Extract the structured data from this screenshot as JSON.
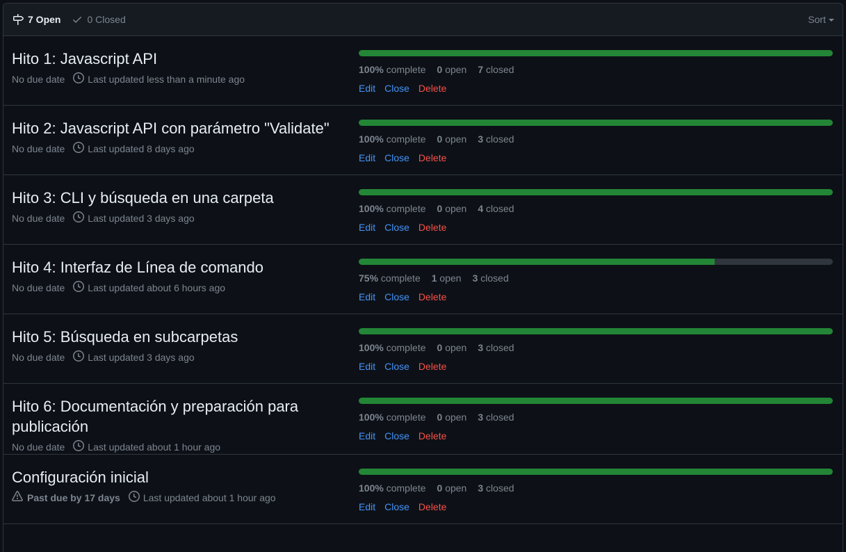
{
  "header": {
    "open_label": "7 Open",
    "closed_label": "0 Closed",
    "sort_label": "Sort"
  },
  "colors": {
    "progress_fill": "#238636",
    "progress_track": "#30363d",
    "link": "#4493f8",
    "danger": "#f85149"
  },
  "milestones": [
    {
      "title": "Hito 1: Javascript API",
      "due": "No due date",
      "updated": "Last updated less than a minute ago",
      "progress": 1.0,
      "percent_label": "100%",
      "complete_label": "complete",
      "open_count": "0",
      "open_label": "open",
      "closed_count": "7",
      "closed_label": "closed",
      "edit": "Edit",
      "close": "Close",
      "delete": "Delete"
    },
    {
      "title": "Hito 2: Javascript API con parámetro \"Validate\"",
      "due": "No due date",
      "updated": "Last updated 8 days ago",
      "progress": 1.0,
      "percent_label": "100%",
      "complete_label": "complete",
      "open_count": "0",
      "open_label": "open",
      "closed_count": "3",
      "closed_label": "closed",
      "edit": "Edit",
      "close": "Close",
      "delete": "Delete"
    },
    {
      "title": "Hito 3: CLI y búsqueda en una carpeta",
      "due": "No due date",
      "updated": "Last updated 3 days ago",
      "progress": 1.0,
      "percent_label": "100%",
      "complete_label": "complete",
      "open_count": "0",
      "open_label": "open",
      "closed_count": "4",
      "closed_label": "closed",
      "edit": "Edit",
      "close": "Close",
      "delete": "Delete"
    },
    {
      "title": "Hito 4: Interfaz de Línea de comando",
      "due": "No due date",
      "updated": "Last updated about 6 hours ago",
      "progress": 0.75,
      "percent_label": "75%",
      "complete_label": "complete",
      "open_count": "1",
      "open_label": "open",
      "closed_count": "3",
      "closed_label": "closed",
      "edit": "Edit",
      "close": "Close",
      "delete": "Delete"
    },
    {
      "title": "Hito 5: Búsqueda en subcarpetas",
      "due": "No due date",
      "updated": "Last updated 3 days ago",
      "progress": 1.0,
      "percent_label": "100%",
      "complete_label": "complete",
      "open_count": "0",
      "open_label": "open",
      "closed_count": "3",
      "closed_label": "closed",
      "edit": "Edit",
      "close": "Close",
      "delete": "Delete"
    },
    {
      "title": "Hito 6: Documentación y preparación para publicación",
      "due": "No due date",
      "updated": "Last updated about 1 hour ago",
      "progress": 1.0,
      "percent_label": "100%",
      "complete_label": "complete",
      "open_count": "0",
      "open_label": "open",
      "closed_count": "3",
      "closed_label": "closed",
      "edit": "Edit",
      "close": "Close",
      "delete": "Delete"
    },
    {
      "title": "Configuración inicial",
      "due": "Past due by 17 days",
      "past_due": true,
      "updated": "Last updated about 1 hour ago",
      "progress": 1.0,
      "percent_label": "100%",
      "complete_label": "complete",
      "open_count": "0",
      "open_label": "open",
      "closed_count": "3",
      "closed_label": "closed",
      "edit": "Edit",
      "close": "Close",
      "delete": "Delete"
    }
  ]
}
